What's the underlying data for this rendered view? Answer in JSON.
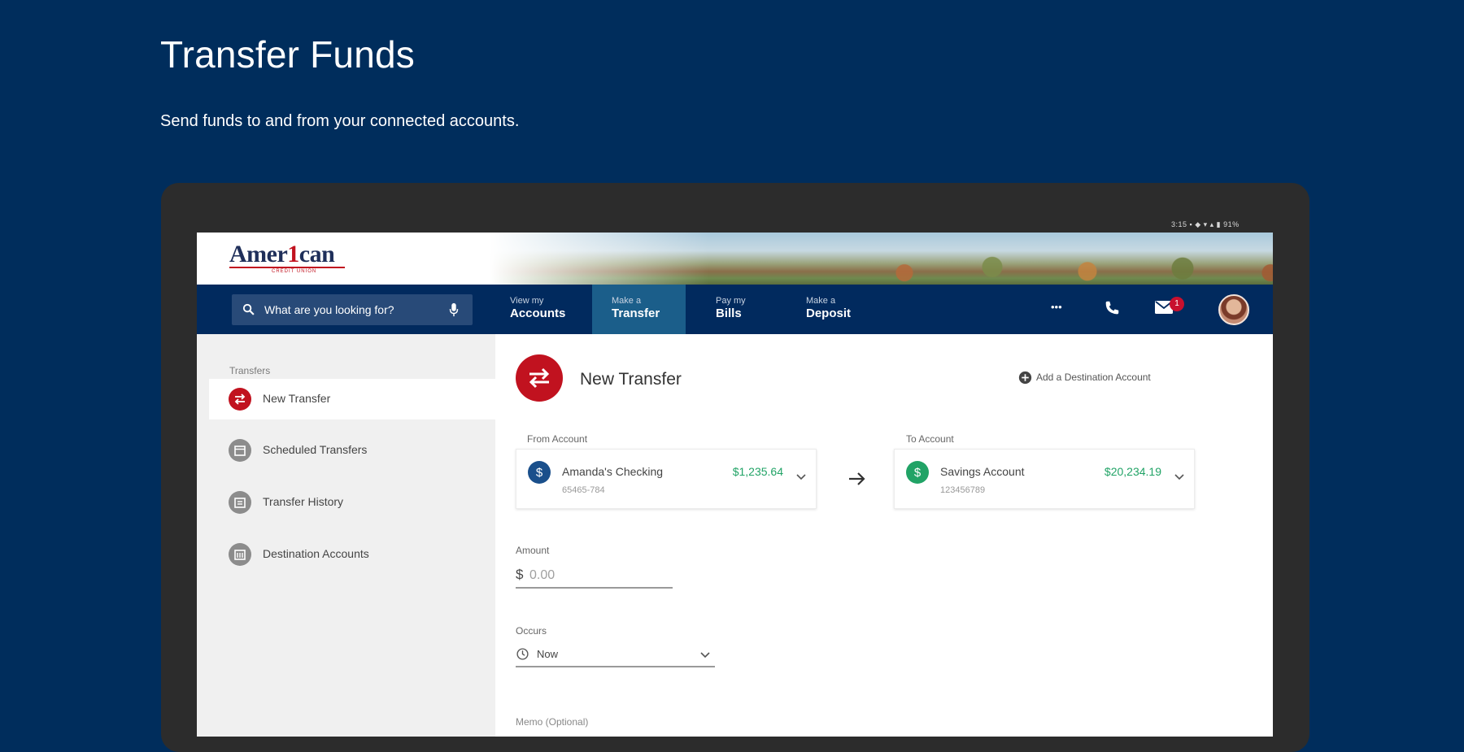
{
  "header": {
    "title": "Transfer Funds",
    "subtitle": "Send funds to and from your connected accounts."
  },
  "status_bar": {
    "text": "3:15  ▪ ◆ ▾ ▴ ▮ 91%"
  },
  "brand": {
    "logo_prefix": "Amer",
    "logo_one": "1",
    "logo_suffix": "can",
    "logo_sub": "CREDIT UNION"
  },
  "nav": {
    "search_placeholder": "What are you looking for?",
    "items": [
      {
        "small": "View my",
        "big": "Accounts"
      },
      {
        "small": "Make a",
        "big": "Transfer"
      },
      {
        "small": "Pay my",
        "big": "Bills"
      },
      {
        "small": "Make a",
        "big": "Deposit"
      }
    ],
    "messages_count": "1",
    "more_label": "•••"
  },
  "sidebar": {
    "title": "Transfers",
    "items": [
      {
        "label": "New Transfer",
        "icon": "swap-icon",
        "active": true
      },
      {
        "label": "Scheduled Transfers",
        "icon": "calendar-icon"
      },
      {
        "label": "Transfer History",
        "icon": "history-icon"
      },
      {
        "label": "Destination Accounts",
        "icon": "bank-icon"
      }
    ]
  },
  "main": {
    "title": "New Transfer",
    "add_destination": "Add a Destination Account",
    "from_label": "From Account",
    "to_label": "To Account",
    "from_account": {
      "name": "Amanda's Checking",
      "number": "65465-784",
      "balance": "$1,235.64"
    },
    "to_account": {
      "name": "Savings Account",
      "number": "123456789",
      "balance": "$20,234.19"
    },
    "amount_label": "Amount",
    "amount_currency": "$",
    "amount_placeholder": "0.00",
    "occurs_label": "Occurs",
    "occurs_value": "Now",
    "memo_label": "Memo (Optional)"
  },
  "colors": {
    "background": "#002d5c",
    "nav": "#012a5e",
    "nav_active": "#1b5e8a",
    "accent_red": "#c1121f",
    "balance_green": "#21a366"
  }
}
